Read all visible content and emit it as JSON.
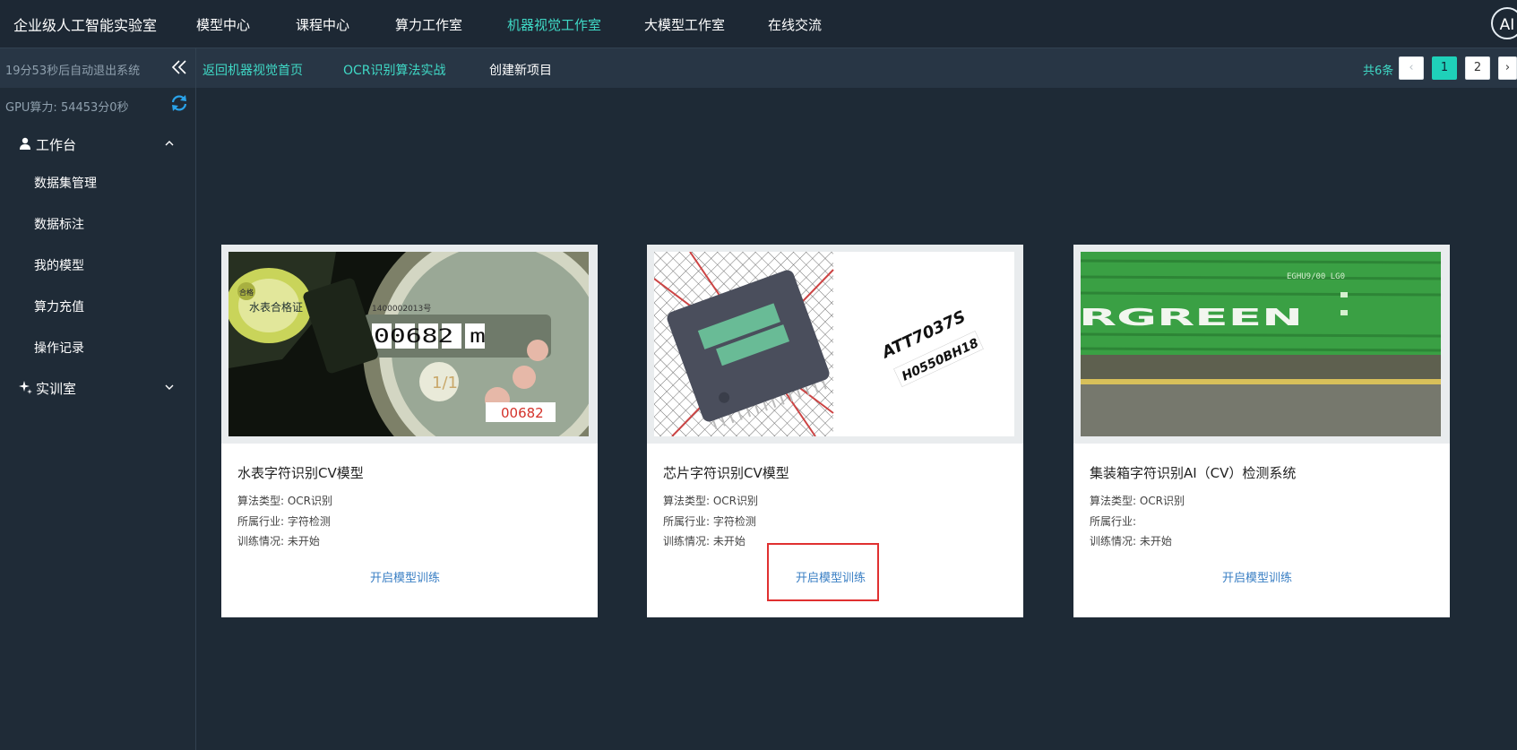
{
  "app": {
    "title": "企业级人工智能实验室",
    "avatar_text": "AI"
  },
  "nav": [
    {
      "label": "模型中心",
      "active": false
    },
    {
      "label": "课程中心",
      "active": false
    },
    {
      "label": "算力工作室",
      "active": false
    },
    {
      "label": "机器视觉工作室",
      "active": true
    },
    {
      "label": "大模型工作室",
      "active": false
    },
    {
      "label": "在线交流",
      "active": false
    }
  ],
  "sidebar": {
    "autologout": "19分53秒后自动退出系统",
    "gpu": "GPU算力: 54453分0秒",
    "workbench": {
      "label": "工作台",
      "expanded": true,
      "items": [
        "数据集管理",
        "数据标注",
        "我的模型",
        "算力充值",
        "操作记录"
      ]
    },
    "lab": {
      "label": "实训室",
      "expanded": false
    }
  },
  "subbar": {
    "links": [
      "返回机器视觉首页",
      "OCR识别算法实战",
      "创建新项目"
    ],
    "total": "共6条",
    "pages": [
      "1",
      "2"
    ],
    "current_page": 1,
    "prev_icon": "‹",
    "next_icon": "›"
  },
  "cards": [
    {
      "title": "水表字符识别CV模型",
      "algo": "算法类型: OCR识别",
      "industry": "所属行业: 字符检测",
      "status": "训练情况: 未开始",
      "action": "开启模型训练",
      "image": {
        "reading": "00682",
        "meter_digits": "00682 m",
        "meter_serial": "1400002013号",
        "meter_reading_label": "1/1",
        "seal_text": "水表合格证",
        "cert_badge": "合格"
      }
    },
    {
      "title": "芯片字符识别CV模型",
      "algo": "算法类型: OCR识别",
      "industry": "所属行业: 字符检测",
      "status": "训练情况: 未开始",
      "action": "开启模型训练",
      "image": {
        "chip_line1": "ATT7037S",
        "chip_line2": "H0550BH18"
      }
    },
    {
      "title": "集装箱字符识别AI（CV）检测系统",
      "algo": "算法类型: OCR识别",
      "industry": "所属行业:",
      "status": "训练情况: 未开始",
      "action": "开启模型训练",
      "image": {
        "container_text": "RGREEN",
        "container_code": "EGHU9/00 LG0"
      }
    }
  ]
}
